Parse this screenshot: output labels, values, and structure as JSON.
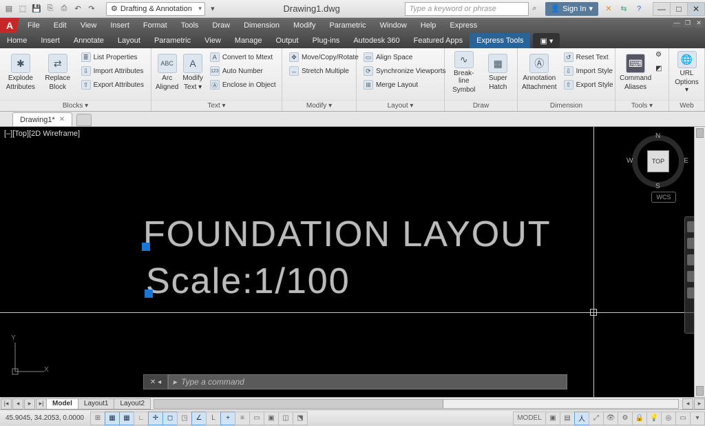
{
  "title": "Drawing1.dwg",
  "workspace": "Drafting & Annotation",
  "search_placeholder": "Type a keyword or phrase",
  "signin": "Sign In",
  "menu1": [
    "File",
    "Edit",
    "View",
    "Insert",
    "Format",
    "Tools",
    "Draw",
    "Dimension",
    "Modify",
    "Parametric",
    "Window",
    "Help",
    "Express"
  ],
  "menu2": [
    "Home",
    "Insert",
    "Annotate",
    "Layout",
    "Parametric",
    "View",
    "Manage",
    "Output",
    "Plug-ins",
    "Autodesk 360",
    "Featured Apps",
    "Express Tools"
  ],
  "ribbon": {
    "blocks": {
      "title": "Blocks ▾",
      "big": [
        {
          "l1": "Explode",
          "l2": "Attributes"
        },
        {
          "l1": "Replace",
          "l2": "Block"
        }
      ],
      "small": [
        "List Properties",
        "Import Attributes",
        "Export Attributes"
      ]
    },
    "text": {
      "title": "Text ▾",
      "big": [
        {
          "l1": "Arc",
          "l2": "Aligned"
        },
        {
          "l1": "Modify",
          "l2": "Text ▾"
        }
      ],
      "small": [
        "Convert to Mtext",
        "Auto Number",
        "Enclose in Object"
      ]
    },
    "modify": {
      "title": "Modify ▾",
      "small": [
        "Move/Copy/Rotate",
        "Stretch Multiple"
      ]
    },
    "layout": {
      "title": "Layout ▾",
      "small": [
        "Align Space",
        "Synchronize Viewports",
        "Merge Layout"
      ]
    },
    "draw": {
      "title": "Draw",
      "big": [
        {
          "l1": "Break-line",
          "l2": "Symbol"
        },
        {
          "l1": "Super",
          "l2": "Hatch"
        }
      ]
    },
    "dimension": {
      "title": "Dimension",
      "big": [
        {
          "l1": "Annotation",
          "l2": "Attachment"
        }
      ],
      "small": [
        "Reset Text",
        "Import Style",
        "Export Style"
      ]
    },
    "tools": {
      "title": "Tools ▾",
      "big": [
        {
          "l1": "Command",
          "l2": "Aliases"
        }
      ]
    },
    "web": {
      "title": "Web",
      "big": [
        {
          "l1": "URL",
          "l2": "Options ▾"
        }
      ]
    }
  },
  "filetab": "Drawing1*",
  "viewlabel": "[–][Top][2D Wireframe]",
  "drawing_text1": "FOUNDATION LAYOUT",
  "drawing_text2": "Scale:1/100",
  "navcube": {
    "top": "TOP",
    "n": "N",
    "s": "S",
    "e": "E",
    "w": "W"
  },
  "wcs": "WCS",
  "cmd_placeholder": "Type a command",
  "layout_tabs": [
    "Model",
    "Layout1",
    "Layout2"
  ],
  "coords": "45.9045, 34.2053, 0.0000",
  "model_label": "MODEL",
  "ucs": {
    "y": "Y",
    "x": "X"
  }
}
